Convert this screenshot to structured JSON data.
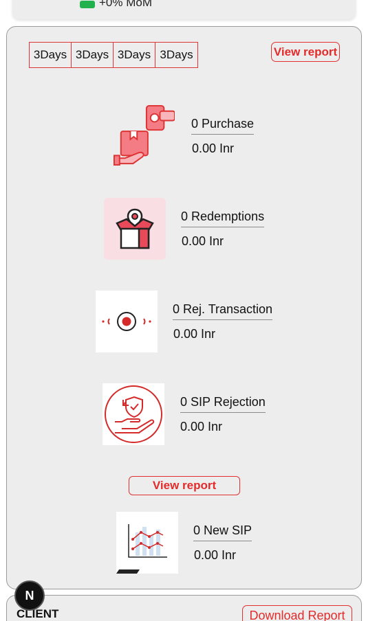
{
  "top_card": {
    "mom_text": "+0% MoM"
  },
  "tabs": [
    "3Days",
    "3Days",
    "3Days",
    "3Days"
  ],
  "actions": {
    "view_report_top": "View report",
    "view_report_mid": "View report",
    "download_report": "Download Report"
  },
  "metrics": [
    {
      "label": "0 Purchase",
      "amount": "0.00 Inr",
      "icon": "purchase-hand-box-icon"
    },
    {
      "label": "0 Redemptions",
      "amount": "0.00 Inr",
      "icon": "gift-box-location-icon"
    },
    {
      "label": "0 Rej. Transaction",
      "amount": "0.00 Inr",
      "icon": "rejection-record-icon"
    },
    {
      "label": "0 SIP Rejection",
      "amount": "0.00 Inr",
      "icon": "shield-hand-icon"
    },
    {
      "label": "0 New SIP",
      "amount": "0.00 Inr",
      "icon": "line-chart-icon"
    }
  ],
  "client": {
    "label": "CLIENT"
  },
  "badge": {
    "text": "N"
  },
  "colors": {
    "accent": "#e32b2b",
    "card": "#ededed",
    "pink": "#f9dfe3"
  }
}
